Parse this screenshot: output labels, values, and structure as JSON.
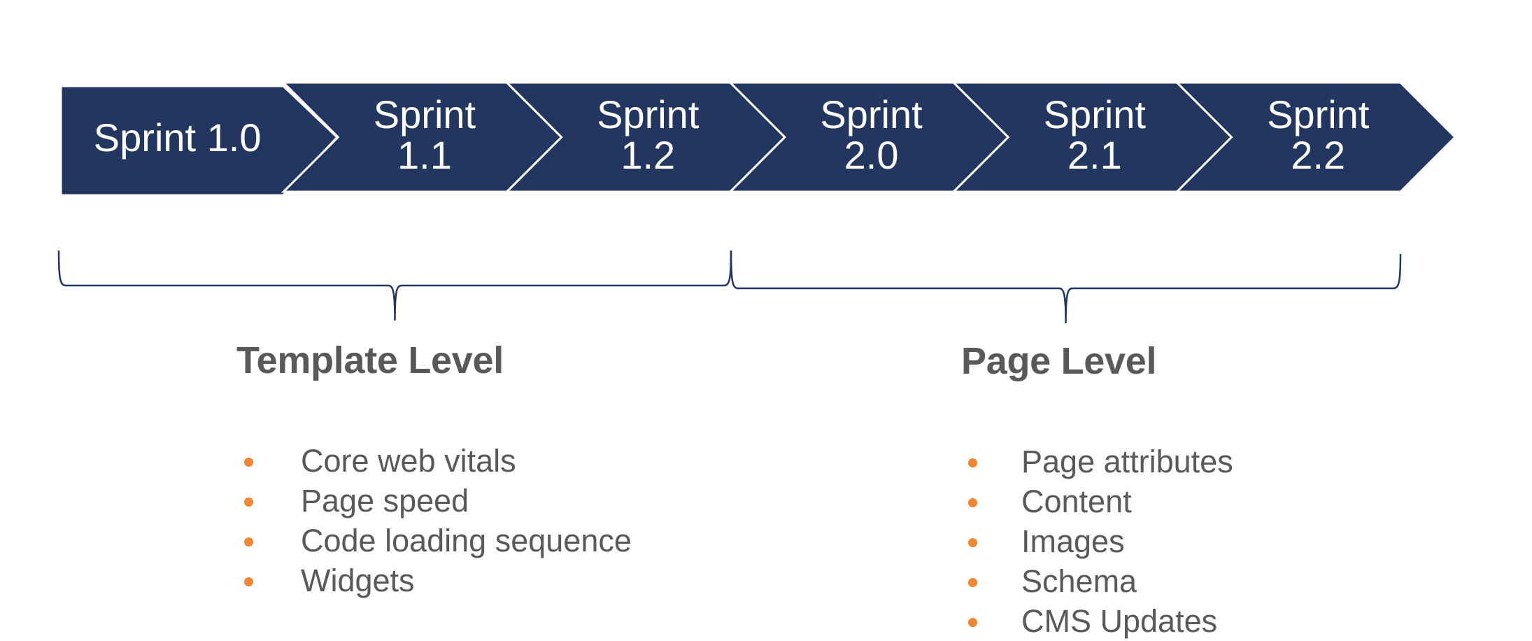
{
  "colors": {
    "chevron_fill": "#22365f",
    "chevron_divider": "#ffffff",
    "bracket_stroke": "#22365f",
    "text": "#58595b",
    "bullet": "#f08533"
  },
  "sprints": [
    {
      "line1": "Sprint 1.0",
      "line2": ""
    },
    {
      "line1": "Sprint",
      "line2": "1.1"
    },
    {
      "line1": "Sprint",
      "line2": "1.2"
    },
    {
      "line1": "Sprint",
      "line2": "2.0"
    },
    {
      "line1": "Sprint",
      "line2": "2.1"
    },
    {
      "line1": "Sprint",
      "line2": "2.2"
    }
  ],
  "groups": [
    {
      "title": "Template Level",
      "spans_sprints": [
        "Sprint 1.0",
        "Sprint 1.1",
        "Sprint 1.2"
      ],
      "items": [
        "Core web vitals",
        "Page speed",
        "Code loading sequence",
        "Widgets"
      ]
    },
    {
      "title": "Page Level",
      "spans_sprints": [
        "Sprint 2.0",
        "Sprint 2.1",
        "Sprint 2.2"
      ],
      "items": [
        "Page attributes",
        "Content",
        "Images",
        "Schema",
        "CMS Updates"
      ]
    }
  ]
}
